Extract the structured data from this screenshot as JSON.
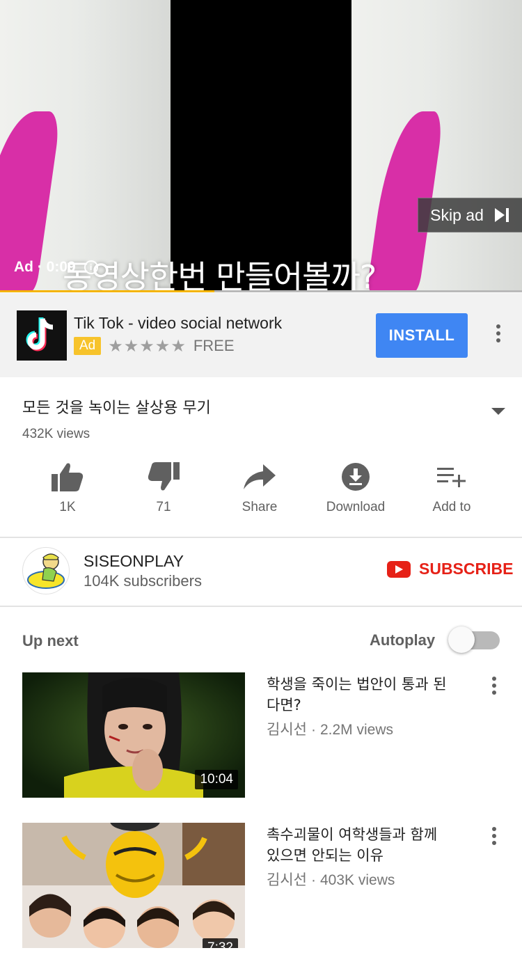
{
  "player": {
    "subtitle": "동영상한번 만들어볼까?",
    "ad_label": "Ad · 0:09",
    "skip_label": "Skip ad",
    "progress_fraction": 0.41,
    "progress_color": "#f4b400"
  },
  "ad": {
    "app_name": "Tik Tok - video social network",
    "badge": "Ad",
    "stars": "★★★★★",
    "price": "FREE",
    "install_label": "INSTALL",
    "install_color": "#3f86f3"
  },
  "video": {
    "title": "모든 것을 녹이는 살상용 무기",
    "views": "432K views"
  },
  "actions": [
    {
      "icon": "thumbs-up-icon",
      "label": "1K"
    },
    {
      "icon": "thumbs-down-icon",
      "label": "71"
    },
    {
      "icon": "share-icon",
      "label": "Share"
    },
    {
      "icon": "download-icon",
      "label": "Download"
    },
    {
      "icon": "add-to-playlist-icon",
      "label": "Add to"
    }
  ],
  "channel": {
    "name": "SISEONPLAY",
    "subscribers": "104K subscribers",
    "subscribe_label": "SUBSCRIBE",
    "subscribe_color": "#e62117"
  },
  "upnext": {
    "label": "Up next",
    "autoplay_label": "Autoplay",
    "autoplay_on": false
  },
  "recommendations": [
    {
      "title": "학생을 죽이는 법안이 통과 된다면?",
      "channel": "김시선",
      "views": "2.2M views",
      "duration": "10:04"
    },
    {
      "title": "촉수괴물이 여학생들과 함께 있으면 안되는 이유",
      "channel": "김시선",
      "views": "403K views",
      "duration": "7:32"
    }
  ]
}
